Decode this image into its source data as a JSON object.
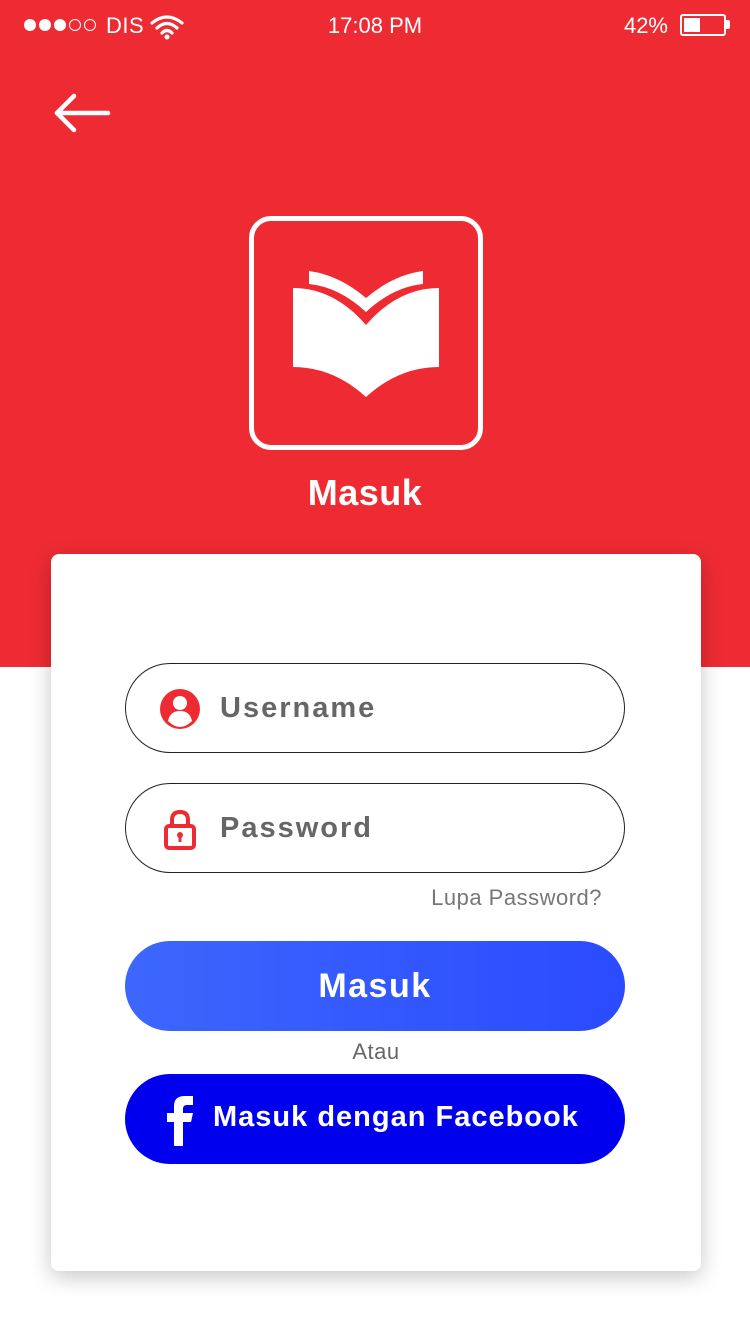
{
  "status_bar": {
    "carrier": "DIS",
    "time": "17:08 PM",
    "battery_percent": "42%",
    "battery_level": 0.42,
    "signal_bars_filled": 3,
    "signal_bars_total": 5
  },
  "header": {
    "title": "Masuk",
    "background_color": "#ee2b33"
  },
  "form": {
    "username_placeholder": "Username",
    "password_placeholder": "Password",
    "forgot_password": "Lupa Password?",
    "login_button": "Masuk",
    "separator": "Atau",
    "facebook_button": "Masuk dengan Facebook"
  },
  "colors": {
    "accent_red": "#ee2b33",
    "login_blue": "#2b4bff",
    "facebook_blue": "#0000ee"
  },
  "icons": {
    "back": "arrow-left-icon",
    "logo": "open-book-icon",
    "username": "user-icon",
    "password": "lock-icon",
    "facebook": "facebook-icon"
  }
}
